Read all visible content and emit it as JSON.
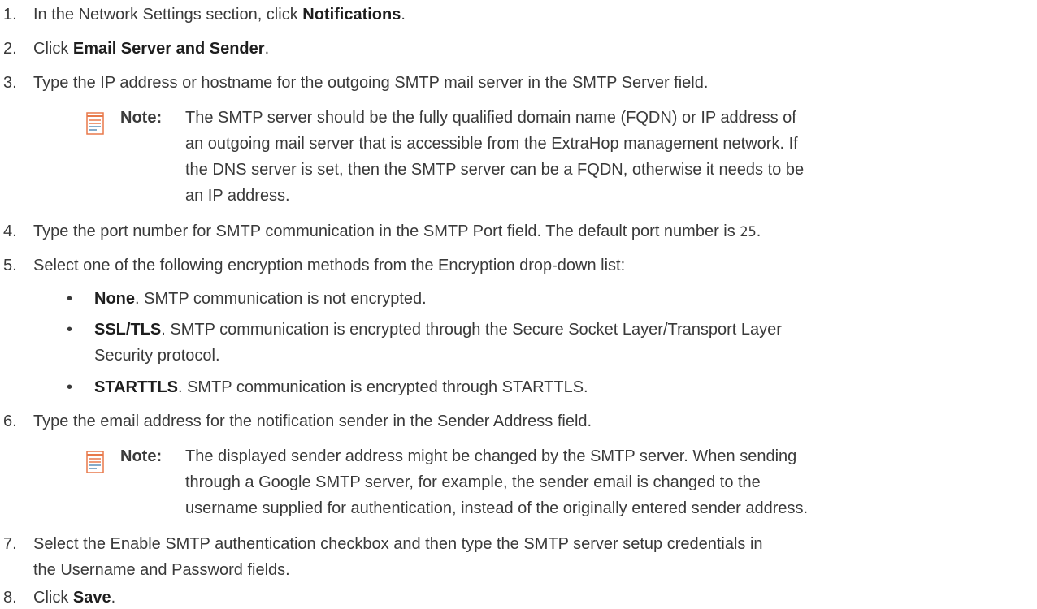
{
  "steps": [
    {
      "num": "1.",
      "pre": "In the Network Settings section, click ",
      "bold": "Notifications",
      "post": "."
    },
    {
      "num": "2.",
      "pre": "Click ",
      "bold": "Email Server and Sender",
      "post": "."
    },
    {
      "num": "3.",
      "text": "Type the IP address or hostname for the outgoing SMTP mail server in the SMTP Server field."
    },
    {
      "num": "4.",
      "pre": "Type the port number for SMTP communication in the SMTP Port field. The default port number is ",
      "code": "25",
      "post": "."
    },
    {
      "num": "5.",
      "text": "Select one of the following encryption methods from the Encryption drop-down list:"
    },
    {
      "num": "6.",
      "text": "Type the email address for the notification sender in the Sender Address field."
    },
    {
      "num": "7.",
      "line1": "Select the Enable SMTP authentication checkbox and then type the SMTP server setup credentials in",
      "line2": "the Username and Password fields."
    },
    {
      "num": "8.",
      "pre": "Click ",
      "bold": "Save",
      "post": "."
    }
  ],
  "note1": {
    "label": "Note:",
    "lines": [
      "The SMTP server should be the fully qualified domain name (FQDN) or IP address of",
      "an outgoing mail server that is accessible from the ExtraHop management network. If",
      "the DNS server is set, then the SMTP server can be a FQDN, otherwise it needs to be",
      "an IP address."
    ]
  },
  "encryption_options": [
    {
      "bullet": "•",
      "bold": "None",
      "lines": [
        ". SMTP communication is not encrypted."
      ]
    },
    {
      "bullet": "•",
      "bold": "SSL/TLS",
      "lines": [
        ". SMTP communication is encrypted through the Secure Socket Layer/Transport Layer",
        "Security protocol."
      ]
    },
    {
      "bullet": "•",
      "bold": "STARTTLS",
      "lines": [
        ". SMTP communication is encrypted through STARTTLS."
      ]
    }
  ],
  "note2": {
    "label": "Note:",
    "lines": [
      "The displayed sender address might be changed by the SMTP server. When sending",
      "through a Google SMTP server, for example, the sender email is changed to the",
      "username supplied for authentication, instead of the originally entered sender address."
    ]
  },
  "colors": {
    "text": "#3a3a3a",
    "note_icon": "#e8794a",
    "note_icon_lines": "#5b8fb9"
  }
}
